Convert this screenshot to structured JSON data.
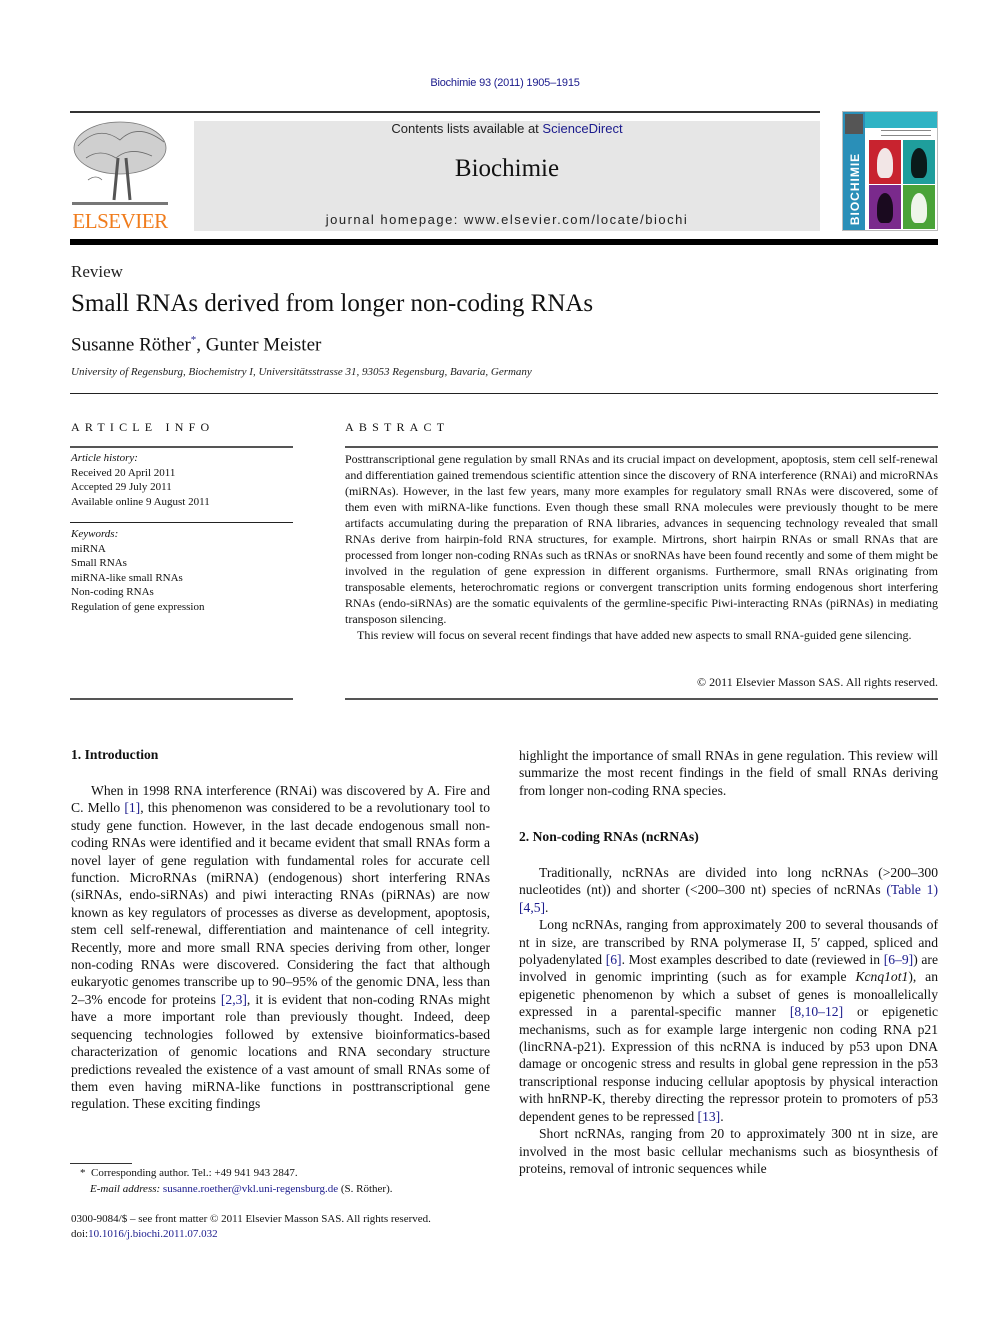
{
  "header": {
    "journal_ref": "Biochimie 93 (2011) 1905–1915",
    "contents_prefix": "Contents lists available at ",
    "contents_link": "ScienceDirect",
    "journal_title": "Biochimie",
    "homepage_prefix": "journal homepage: ",
    "homepage_url": "www.elsevier.com/locate/biochi",
    "publisher_logo_text": "ELSEVIER",
    "cover_spine_text": "BIOCHIMIE"
  },
  "colors": {
    "link": "#1a1a8c",
    "elsevier_orange": "#f07c1c",
    "masthead_bg": "#e6e6e6",
    "cover_spine": "#2a8fb8"
  },
  "article": {
    "type": "Review",
    "title": "Small RNAs derived from longer non-coding RNAs",
    "authors": [
      {
        "name": "Susanne Röther",
        "mark": "*"
      },
      {
        "name": "Gunter Meister",
        "mark": ""
      }
    ],
    "author_separator": ", ",
    "affiliation": "University of Regensburg, Biochemistry I, Universitätsstrasse 31, 93053 Regensburg, Bavaria, Germany"
  },
  "article_info": {
    "heading": "ARTICLE INFO",
    "history_label": "Article history:",
    "history": [
      "Received 20 April 2011",
      "Accepted 29 July 2011",
      "Available online 9 August 2011"
    ],
    "keywords_label": "Keywords:",
    "keywords": [
      "miRNA",
      "Small RNAs",
      "miRNA-like small RNAs",
      "Non-coding RNAs",
      "Regulation of gene expression"
    ]
  },
  "abstract": {
    "heading": "ABSTRACT",
    "paragraphs": [
      "Posttranscriptional gene regulation by small RNAs and its crucial impact on development, apoptosis, stem cell self-renewal and differentiation gained tremendous scientific attention since the discovery of RNA interference (RNAi) and microRNAs (miRNAs). However, in the last few years, many more examples for regulatory small RNAs were discovered, some of them even with miRNA-like functions. Even though these small RNA molecules were previously thought to be mere artifacts accumulating during the preparation of RNA libraries, advances in sequencing technology revealed that small RNAs derive from hairpin-fold RNA structures, for example. Mirtrons, short hairpin RNAs or small RNAs that are processed from longer non-coding RNAs such as tRNAs or snoRNAs have been found recently and some of them might be involved in the regulation of gene expression in different organisms. Furthermore, small RNAs originating from transposable elements, heterochromatic regions or convergent transcription units forming endogenous short interfering RNAs (endo-siRNAs) are the somatic equivalents of the germline-specific Piwi-interacting RNAs (piRNAs) in mediating transposon silencing.",
      "This review will focus on several recent findings that have added new aspects to small RNA-guided gene silencing."
    ],
    "copyright": "© 2011 Elsevier Masson SAS. All rights reserved."
  },
  "body": {
    "section1": {
      "heading": "1.  Introduction",
      "p1": [
        {
          "t": "When in 1998 RNA interference (RNAi) was discovered by A. Fire and C. Mello "
        },
        {
          "t": "[1]",
          "link": true
        },
        {
          "t": ", this phenomenon was considered to be a revolutionary tool to study gene function. However, in the last decade endogenous small non-coding RNAs were identified and it became evident that small RNAs form a novel layer of gene regulation with fundamental roles for accurate cell function. MicroRNAs (miRNA) (endogenous) short interfering RNAs (siRNAs, endo-siRNAs) and piwi interacting RNAs (piRNAs) are now known as key regulators of processes as diverse as development, apoptosis, stem cell self-renewal, differentiation and maintenance of cell integrity. Recently, more and more small RNA species deriving from other, longer non-coding RNAs were discovered. Considering the fact that although eukaryotic genomes transcribe up to 90–95% of the genomic DNA, less than 2–3% encode for proteins "
        },
        {
          "t": "[2,3]",
          "link": true
        },
        {
          "t": ", it is evident that non-coding RNAs might have a more important role than previously thought. Indeed, deep sequencing technologies followed by extensive bioinformatics-based characterization of genomic locations and RNA secondary structure predictions revealed the existence of a vast amount of small RNAs some of them even having miRNA-like functions in posttranscriptional gene regulation. These exciting findings"
        }
      ],
      "p1_continued": "highlight the importance of small RNAs in gene regulation. This review will summarize the most recent findings in the field of small RNAs deriving from longer non-coding RNA species."
    },
    "section2": {
      "heading": "2.  Non-coding RNAs (ncRNAs)",
      "p1": [
        {
          "t": "Traditionally, ncRNAs are divided into long ncRNAs (>200–300 nucleotides (nt)) and shorter (<200–300 nt) species of ncRNAs "
        },
        {
          "t": "(Table 1)",
          "link": true
        },
        {
          "t": " "
        },
        {
          "t": "[4,5]",
          "link": true
        },
        {
          "t": "."
        }
      ],
      "p2": [
        {
          "t": "Long ncRNAs, ranging from approximately 200 to several thousands of nt in size, are transcribed by RNA polymerase II, 5′ capped, spliced and polyadenylated "
        },
        {
          "t": "[6]",
          "link": true
        },
        {
          "t": ". Most examples described to date (reviewed in "
        },
        {
          "t": "[6–9]",
          "link": true
        },
        {
          "t": ") are involved in genomic imprinting (such as for example "
        },
        {
          "t": "Kcnq1ot1",
          "italic": true
        },
        {
          "t": "), an epigenetic phenomenon by which a subset of genes is monoallelically expressed in a parental-specific manner "
        },
        {
          "t": "[8,10–12]",
          "link": true
        },
        {
          "t": " or epigenetic mechanisms, such as for example large intergenic non coding RNA p21 (lincRNA-p21). Expression of this ncRNA is induced by p53 upon DNA damage or oncogenic stress and results in global gene repression in the p53 transcriptional response inducing cellular apoptosis by physical interaction with hnRNP-K, thereby directing the repressor protein to promoters of p53 dependent genes to be repressed "
        },
        {
          "t": "[13]",
          "link": true
        },
        {
          "t": "."
        }
      ],
      "p3": "Short ncRNAs, ranging from 20 to approximately 300 nt in size, are involved in the most basic cellular mechanisms such as biosynthesis of proteins, removal of intronic sequences while"
    }
  },
  "footnotes": {
    "corresponding_mark": "*",
    "corresponding": "Corresponding author. Tel.: +49 941 943 2847.",
    "email_label": "E-mail address:",
    "email": "susanne.roether@vkl.uni-regensburg.de",
    "email_suffix": " (S. Röther).",
    "front_matter": "0300-9084/$ – see front matter © 2011 Elsevier Masson SAS. All rights reserved.",
    "doi_label": "doi:",
    "doi": "10.1016/j.biochi.2011.07.032"
  }
}
